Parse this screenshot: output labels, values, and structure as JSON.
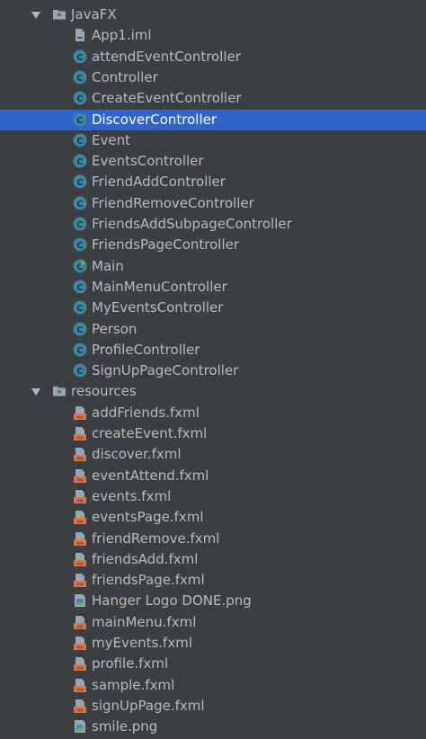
{
  "colors": {
    "background": "#3c3f41",
    "text": "#bbbbbb",
    "selected_background": "#2f65ca",
    "selected_text": "#ffffff",
    "class_icon": "#3e86a0",
    "fxml_icon": "#d9744a",
    "folder_icon": "#9aa7b0"
  },
  "tree": [
    {
      "type": "folder",
      "label": "JavaFX",
      "expanded": true,
      "depth": 0,
      "icon": "folder-icon"
    },
    {
      "type": "file",
      "label": "App1.iml",
      "depth": 1,
      "icon": "iml-file-icon"
    },
    {
      "type": "class",
      "label": "attendEventController",
      "depth": 1,
      "icon": "java-class-icon"
    },
    {
      "type": "class",
      "label": "Controller",
      "depth": 1,
      "icon": "java-class-icon"
    },
    {
      "type": "class",
      "label": "CreateEventController",
      "depth": 1,
      "icon": "java-class-icon"
    },
    {
      "type": "class",
      "label": "DiscoverController",
      "depth": 1,
      "icon": "java-class-icon",
      "selected": true
    },
    {
      "type": "class",
      "label": "Event",
      "depth": 1,
      "icon": "java-class-icon"
    },
    {
      "type": "class",
      "label": "EventsController",
      "depth": 1,
      "icon": "java-class-icon"
    },
    {
      "type": "class",
      "label": "FriendAddController",
      "depth": 1,
      "icon": "java-class-icon"
    },
    {
      "type": "class",
      "label": "FriendRemoveController",
      "depth": 1,
      "icon": "java-class-icon"
    },
    {
      "type": "class",
      "label": "FriendsAddSubpageController",
      "depth": 1,
      "icon": "java-class-icon"
    },
    {
      "type": "class",
      "label": "FriendsPageController",
      "depth": 1,
      "icon": "java-class-icon"
    },
    {
      "type": "main",
      "label": "Main",
      "depth": 1,
      "icon": "java-main-class-icon"
    },
    {
      "type": "class",
      "label": "MainMenuController",
      "depth": 1,
      "icon": "java-class-icon"
    },
    {
      "type": "class",
      "label": "MyEventsController",
      "depth": 1,
      "icon": "java-class-icon"
    },
    {
      "type": "class",
      "label": "Person",
      "depth": 1,
      "icon": "java-class-icon"
    },
    {
      "type": "class",
      "label": "ProfileController",
      "depth": 1,
      "icon": "java-class-icon"
    },
    {
      "type": "class",
      "label": "SignUpPageController",
      "depth": 1,
      "icon": "java-class-icon"
    },
    {
      "type": "folder",
      "label": "resources",
      "expanded": true,
      "depth": 0,
      "icon": "folder-icon"
    },
    {
      "type": "fxml",
      "label": "addFriends.fxml",
      "depth": 1,
      "icon": "fxml-file-icon"
    },
    {
      "type": "fxml",
      "label": "createEvent.fxml",
      "depth": 1,
      "icon": "fxml-file-icon"
    },
    {
      "type": "fxml",
      "label": "discover.fxml",
      "depth": 1,
      "icon": "fxml-file-icon"
    },
    {
      "type": "fxml",
      "label": "eventAttend.fxml",
      "depth": 1,
      "icon": "fxml-file-icon"
    },
    {
      "type": "fxml",
      "label": "events.fxml",
      "depth": 1,
      "icon": "fxml-file-icon"
    },
    {
      "type": "fxml",
      "label": "eventsPage.fxml",
      "depth": 1,
      "icon": "fxml-file-icon"
    },
    {
      "type": "fxml",
      "label": "friendRemove.fxml",
      "depth": 1,
      "icon": "fxml-file-icon"
    },
    {
      "type": "fxml",
      "label": "friendsAdd.fxml",
      "depth": 1,
      "icon": "fxml-file-icon"
    },
    {
      "type": "fxml",
      "label": "friendsPage.fxml",
      "depth": 1,
      "icon": "fxml-file-icon"
    },
    {
      "type": "image",
      "label": "Hanger Logo DONE.png",
      "depth": 1,
      "icon": "png-file-icon"
    },
    {
      "type": "fxml",
      "label": "mainMenu.fxml",
      "depth": 1,
      "icon": "fxml-file-icon"
    },
    {
      "type": "fxml",
      "label": "myEvents.fxml",
      "depth": 1,
      "icon": "fxml-file-icon"
    },
    {
      "type": "fxml",
      "label": "profile.fxml",
      "depth": 1,
      "icon": "fxml-file-icon"
    },
    {
      "type": "fxml",
      "label": "sample.fxml",
      "depth": 1,
      "icon": "fxml-file-icon"
    },
    {
      "type": "fxml",
      "label": "signUpPage.fxml",
      "depth": 1,
      "icon": "fxml-file-icon"
    },
    {
      "type": "image",
      "label": "smile.png",
      "depth": 1,
      "icon": "png-file-icon"
    }
  ]
}
